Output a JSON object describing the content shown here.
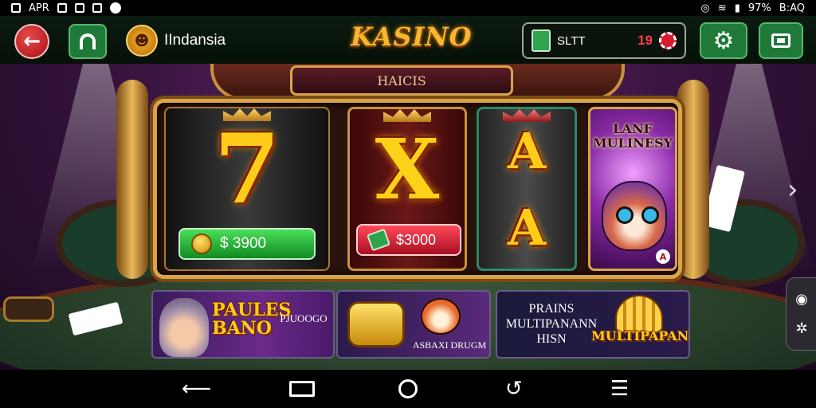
{
  "status_bar": {
    "left_text": "APR",
    "right_text": "97%",
    "time": "B:AQ"
  },
  "header": {
    "user_name": "IIndansia",
    "app_title": "KASINO",
    "wallet_label": "SLTT",
    "wallet_value": "19"
  },
  "slot": {
    "header_label": "HAICIS",
    "reels": [
      {
        "symbol": "7",
        "prize": "$ 3900"
      },
      {
        "symbol": "X",
        "prize": "$3000"
      },
      {
        "symbols": [
          "A",
          "A"
        ]
      },
      {
        "title": "LANF MULINESY",
        "badge": "A"
      }
    ]
  },
  "promos": [
    {
      "title": "PAULES BANO",
      "subtitle": "PJUOOGO"
    },
    {
      "subtitle": "ASBAXI DRUGM"
    },
    {
      "subtitle": "PRAINS MULTIPANANN HISN",
      "title": "MULTIPAPANS"
    }
  ],
  "icons": {
    "back": "arrow-left-icon",
    "home": "home-icon",
    "settings": "gear-icon",
    "menu": "window-icon",
    "next": "chevron-right-icon",
    "nav": [
      "back-icon",
      "recents-icon",
      "home-icon",
      "rotate-icon",
      "menu-icon"
    ]
  },
  "colors": {
    "accent_green": "#1f7a3a",
    "accent_gold": "#f7b733",
    "accent_red": "#d81b2a"
  }
}
